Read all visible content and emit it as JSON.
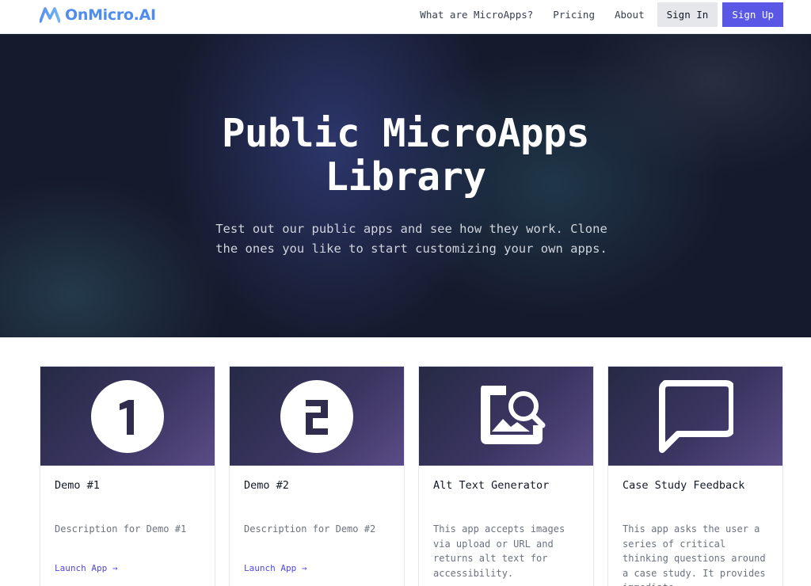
{
  "header": {
    "brand": "OnMicro.AI",
    "nav": [
      "What are MicroApps?",
      "Pricing",
      "About"
    ],
    "sign_in": "Sign In",
    "sign_up": "Sign Up"
  },
  "hero": {
    "title_line1": "Public MicroApps",
    "title_line2": "Library",
    "subtitle_line1": "Test out our public apps and see how they work. Clone",
    "subtitle_line2": "the ones you like to start customizing your own apps."
  },
  "cards": [
    {
      "icon": "number-1-icon",
      "title": "Demo #1",
      "description": "Description for Demo #1",
      "link": "Launch App →"
    },
    {
      "icon": "number-2-icon",
      "title": "Demo #2",
      "description": "Description for Demo #2",
      "link": "Launch App →"
    },
    {
      "icon": "image-search-icon",
      "title": "Alt Text Generator",
      "description": "This app accepts images via upload or URL and returns alt text for accessibility.",
      "link": ""
    },
    {
      "icon": "chat-bubble-icon",
      "title": "Case Study Feedback",
      "description": "This app asks the user a series of critical thinking questions around a case study. It provides immediate",
      "link": ""
    }
  ],
  "colors": {
    "brand": "#4f8cf0",
    "accent": "#5b57e6",
    "hero_bg": "#151a2c",
    "link": "#4f46e5"
  }
}
